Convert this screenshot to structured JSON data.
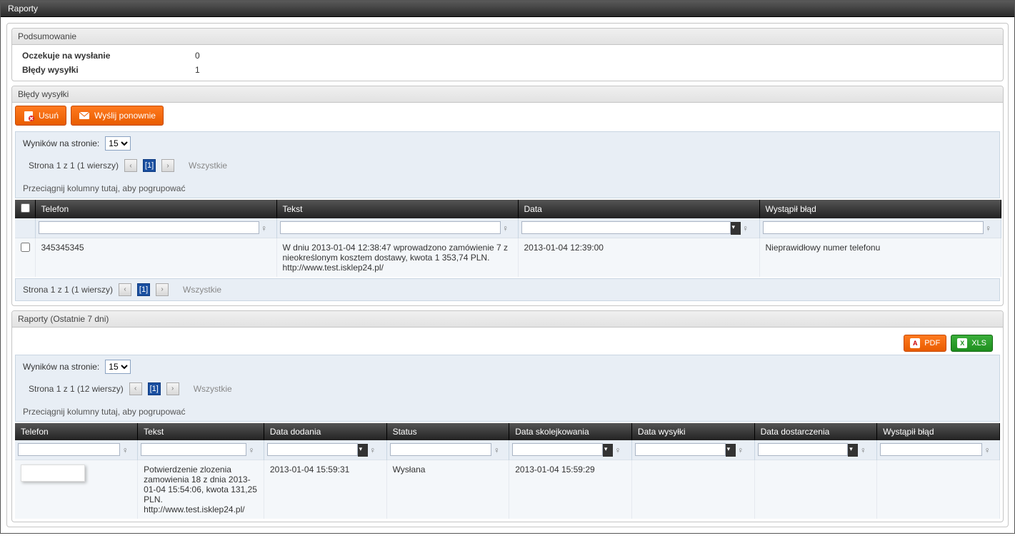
{
  "title": "Raporty",
  "summary": {
    "header": "Podsumowanie",
    "rows": [
      {
        "label": "Oczekuje na wysłanie",
        "value": "0"
      },
      {
        "label": "Błędy wysyłki",
        "value": "1"
      }
    ]
  },
  "errors_panel": {
    "header": "Błędy wysyłki",
    "buttons": {
      "delete": "Usuń",
      "resend": "Wyślij ponownie"
    },
    "results_per_page_label": "Wyników na stronie:",
    "results_per_page_value": "15",
    "pager_text": "Strona 1 z 1 (1 wierszy)",
    "pager_current": "[1]",
    "pager_all": "Wszystkie",
    "group_hint": "Przeciągnij kolumny tutaj, aby pogrupować",
    "columns": [
      "",
      "Telefon",
      "Tekst",
      "Data",
      "Wystąpił błąd"
    ],
    "row": {
      "telefon": "345345345",
      "tekst": "W dniu 2013-01-04 12:38:47 wprowadzono zamówienie 7 z nieokreślonym kosztem dostawy, kwota 1 353,74 PLN. http://www.test.isklep24.pl/",
      "data": "2013-01-04 12:39:00",
      "blad": "Nieprawidłowy numer telefonu"
    }
  },
  "reports_panel": {
    "header": "Raporty (Ostatnie 7 dni)",
    "export": {
      "pdf": "PDF",
      "xls": "XLS"
    },
    "results_per_page_label": "Wyników na stronie:",
    "results_per_page_value": "15",
    "pager_text": "Strona 1 z 1 (12 wierszy)",
    "pager_current": "[1]",
    "pager_all": "Wszystkie",
    "group_hint": "Przeciągnij kolumny tutaj, aby pogrupować",
    "columns": [
      "Telefon",
      "Tekst",
      "Data dodania",
      "Status",
      "Data skolejkowania",
      "Data wysyłki",
      "Data dostarczenia",
      "Wystąpił błąd"
    ],
    "row": {
      "tekst": "Potwierdzenie zlozenia zamowienia 18 z dnia 2013-01-04 15:54:06, kwota 131,25 PLN. http://www.test.isklep24.pl/",
      "data_dodania": "2013-01-04 15:59:31",
      "status": "Wysłana",
      "data_skolejkowania": "2013-01-04 15:59:29"
    }
  }
}
